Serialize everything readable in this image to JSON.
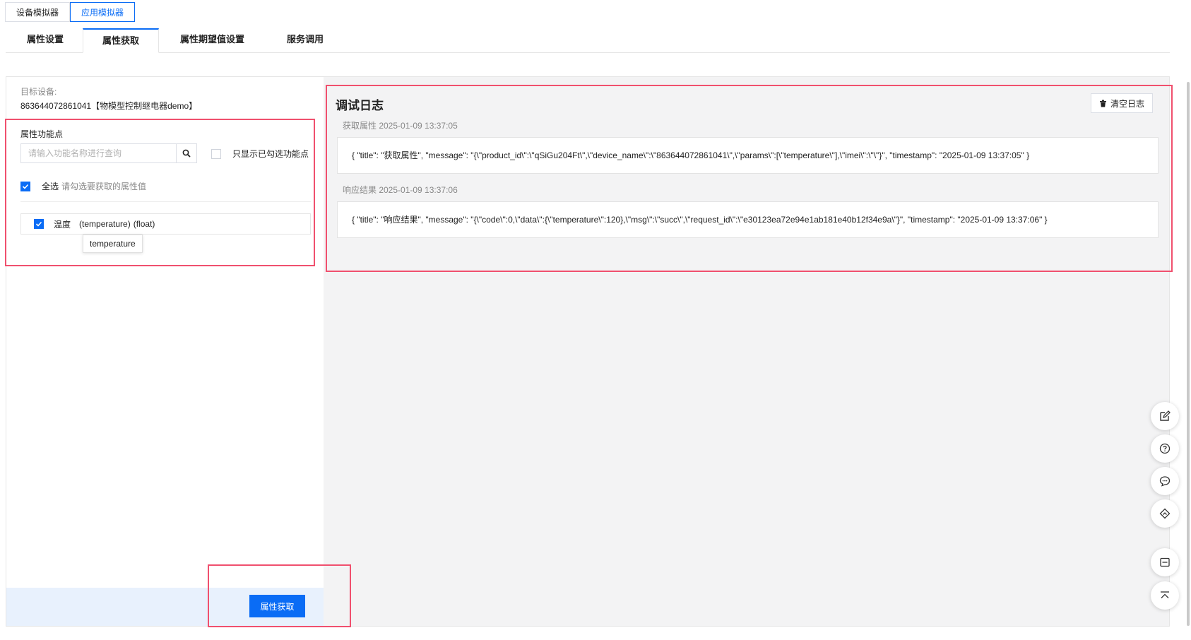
{
  "simulator_switch": {
    "device_sim": "设备模拟器",
    "app_sim": "应用模拟器"
  },
  "tabs": [
    {
      "label": "属性设置"
    },
    {
      "label": "属性获取"
    },
    {
      "label": "属性期望值设置"
    },
    {
      "label": "服务调用"
    }
  ],
  "left": {
    "target_label": "目标设备:",
    "target_value": "863644072861041【物模型控制继电器demo】",
    "prop_label": "属性功能点",
    "search_placeholder": "请输入功能名称进行查询",
    "only_checked_label": "只显示已勾选功能点",
    "select_all_label": "全选",
    "select_all_hint": "请勾选要获取的属性值",
    "property": {
      "name": "温度",
      "identifier": "(temperature)",
      "type": "(float)"
    },
    "tooltip": "temperature",
    "fetch_button": "属性获取"
  },
  "log": {
    "title": "调试日志",
    "clear_button": "清空日志",
    "entries": [
      {
        "head": "获取属性 2025-01-09 13:37:05",
        "body": "{ \"title\": \"获取属性\", \"message\": \"{\\\"product_id\\\":\\\"qSiGu204Ft\\\",\\\"device_name\\\":\\\"863644072861041\\\",\\\"params\\\":[\\\"temperature\\\"],\\\"imei\\\":\\\"\\\"}\", \"timestamp\": \"2025-01-09 13:37:05\" }"
      },
      {
        "head": "响应结果 2025-01-09 13:37:06",
        "body": "{ \"title\": \"响应结果\", \"message\": \"{\\\"code\\\":0,\\\"data\\\":{\\\"temperature\\\":120},\\\"msg\\\":\\\"succ\\\",\\\"request_id\\\":\\\"e30123ea72e94e1ab181e40b12f34e9a\\\"}\", \"timestamp\": \"2025-01-09 13:37:06\" }"
      }
    ]
  },
  "colors": {
    "accent": "#0a6cf5",
    "highlight": "#f0506e",
    "log_bg": "#f3f3f4"
  }
}
